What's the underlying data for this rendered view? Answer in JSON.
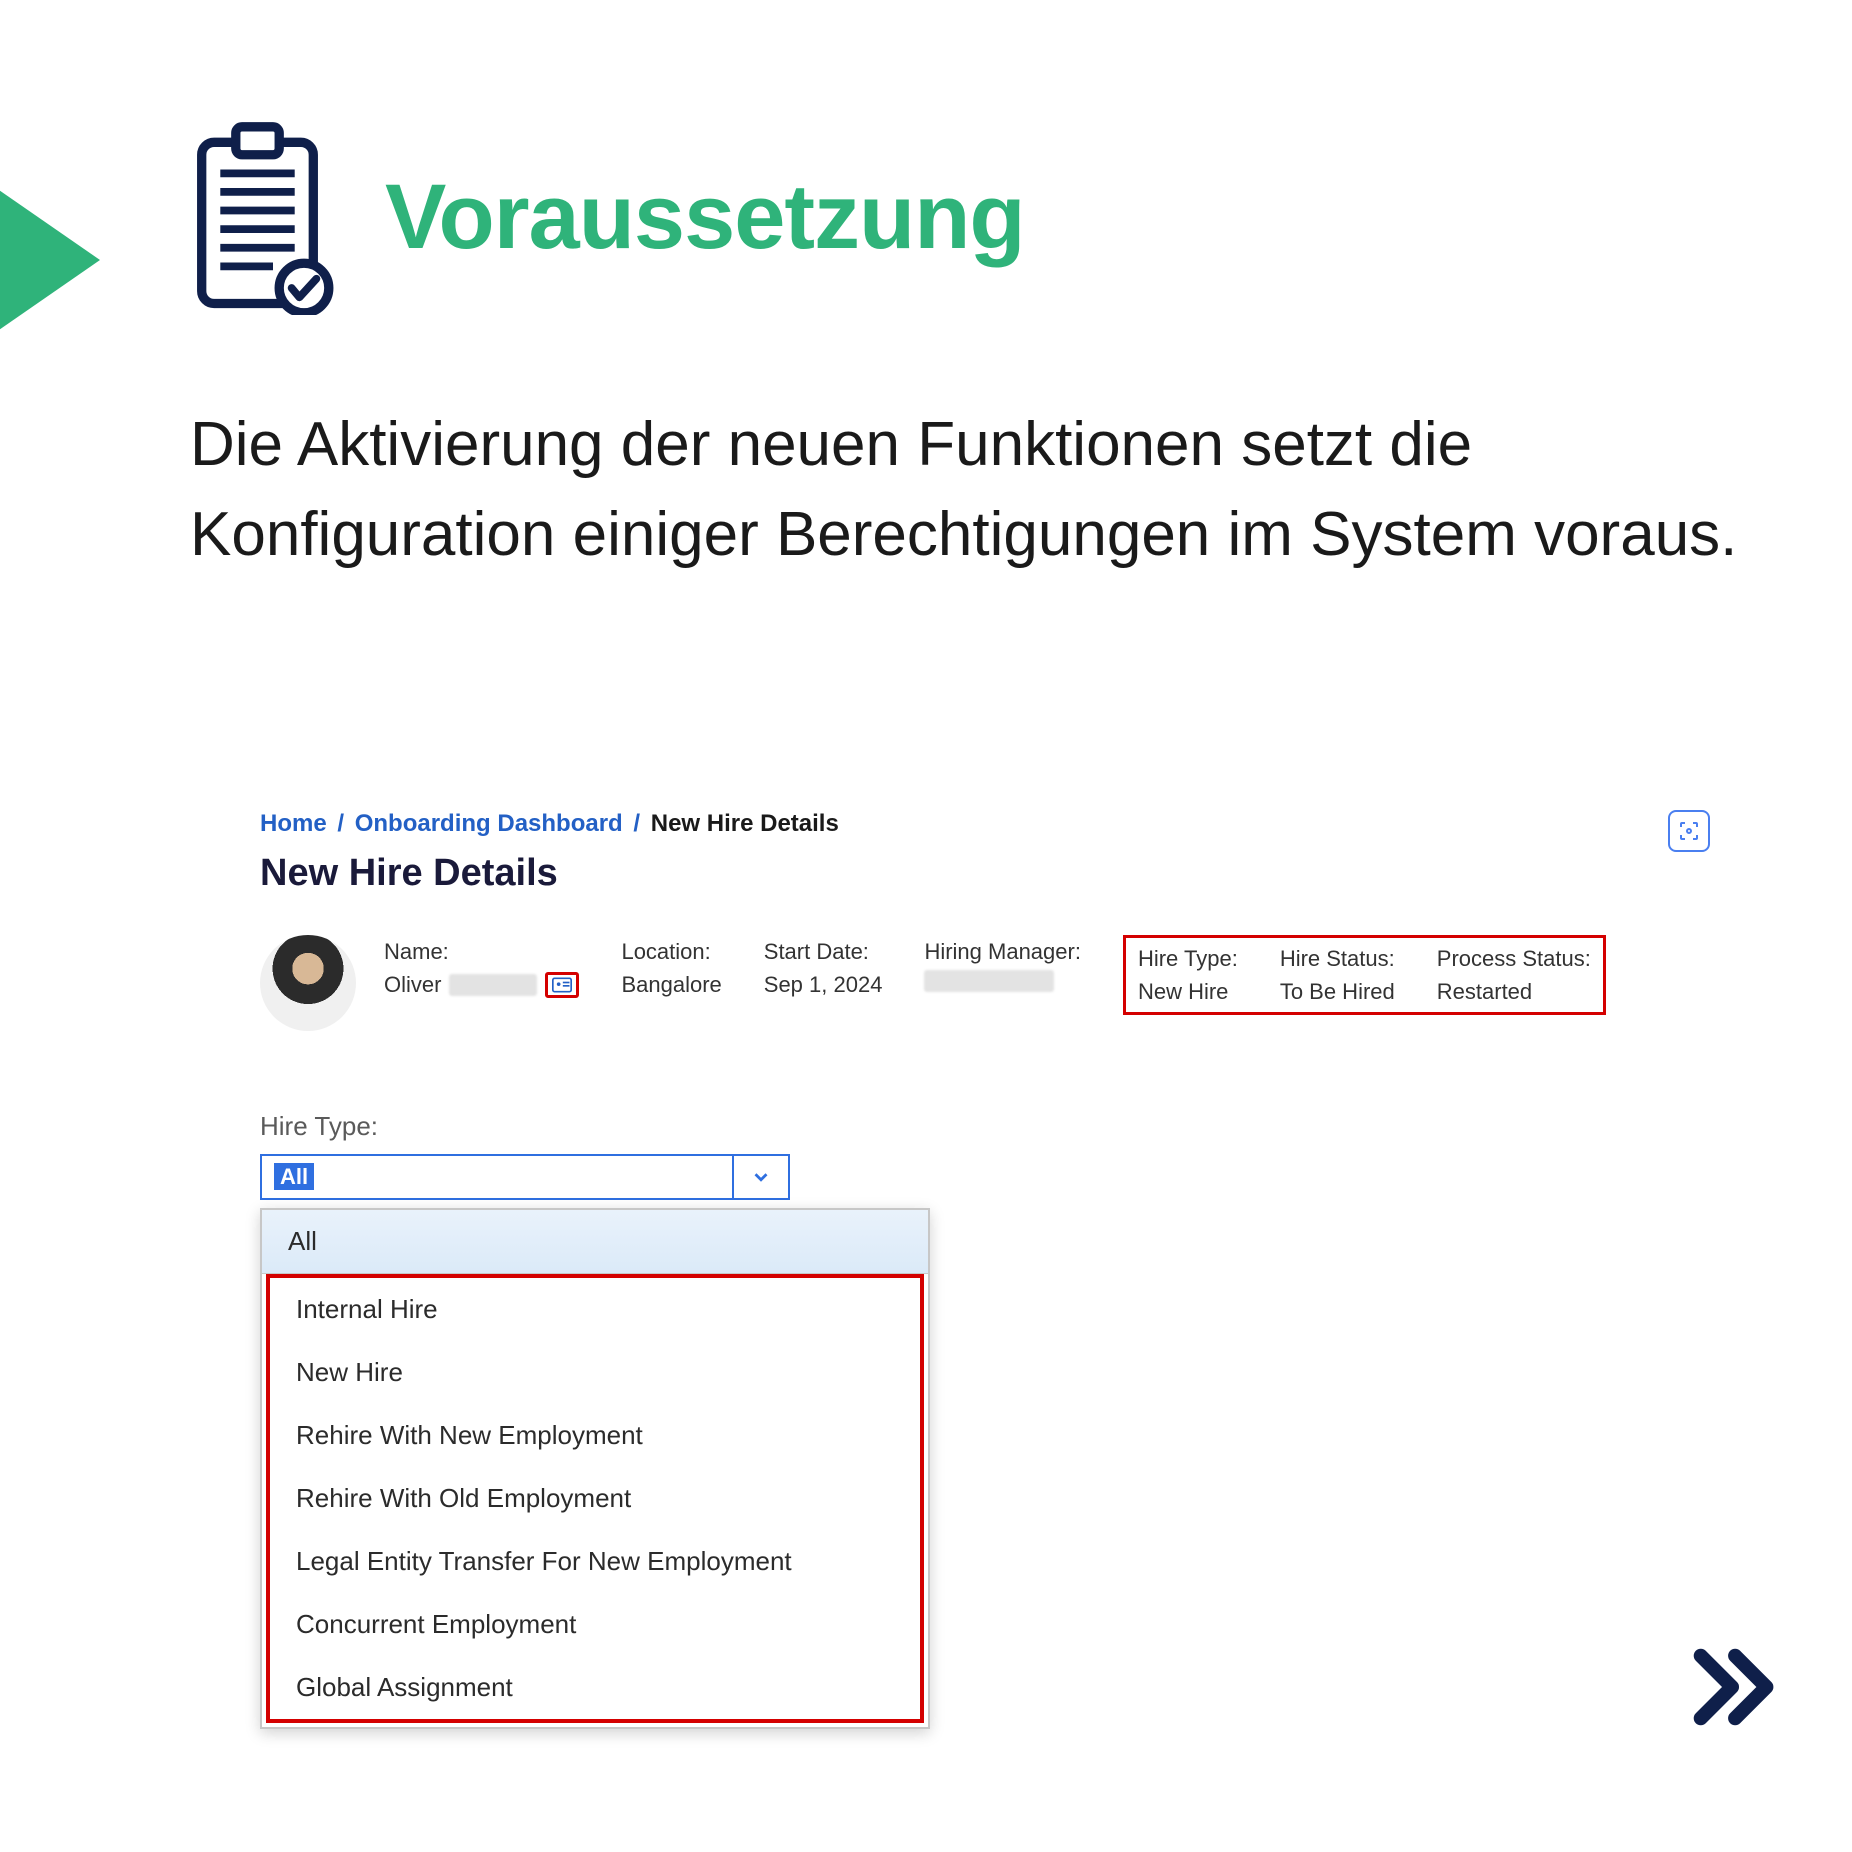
{
  "header": {
    "title": "Voraussetzung",
    "icon_name": "clipboard-check-icon"
  },
  "body": {
    "text": "Die Aktivierung der neuen Funktionen setzt die Konfiguration einiger Berechtigungen im System voraus."
  },
  "screenshot": {
    "breadcrumb": {
      "parts": [
        "Home",
        "Onboarding Dashboard",
        "New Hire Details"
      ],
      "current_index": 2
    },
    "page_title": "New Hire Details",
    "scan_icon": "scan-icon",
    "profile": {
      "name_label": "Name:",
      "name_value": "Oliver",
      "location_label": "Location:",
      "location_value": "Bangalore",
      "start_date_label": "Start Date:",
      "start_date_value": "Sep 1, 2024",
      "hiring_manager_label": "Hiring Manager:",
      "hiring_manager_value": "",
      "hire_type_label": "Hire Type:",
      "hire_type_value": "New Hire",
      "hire_status_label": "Hire Status:",
      "hire_status_value": "To Be Hired",
      "process_status_label": "Process Status:",
      "process_status_value": "Restarted"
    },
    "dropdown": {
      "label": "Hire Type:",
      "selected": "All",
      "options": [
        "All",
        "Internal Hire",
        "New Hire",
        "Rehire With New Employment",
        "Rehire With Old Employment",
        "Legal Entity Transfer For New Employment",
        "Concurrent Employment",
        "Global Assignment"
      ]
    }
  },
  "nav": {
    "next_icon": "double-chevron-right-icon"
  }
}
